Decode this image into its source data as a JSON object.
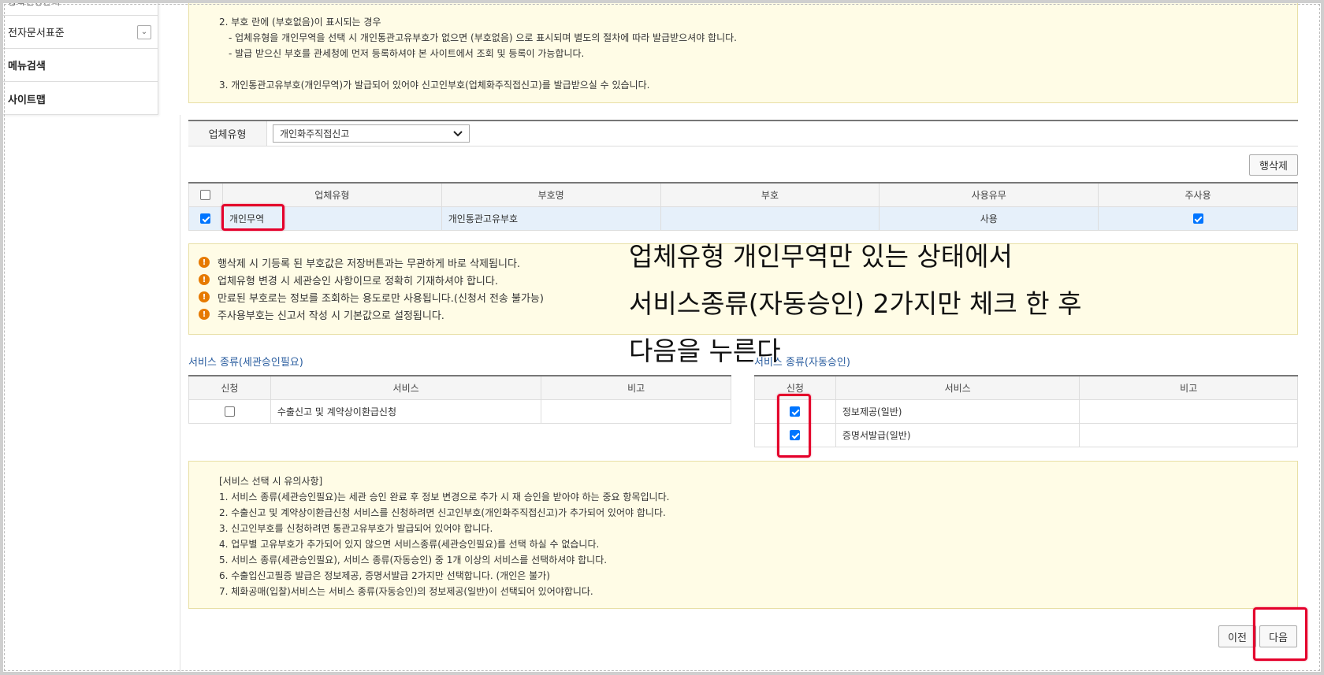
{
  "sidebar": {
    "top_cut": "등록신청관리",
    "items": [
      {
        "label": "전자문서표준",
        "has_toggle": true
      },
      {
        "label": "메뉴검색"
      },
      {
        "label": "사이트맵"
      }
    ],
    "toggle_glyph": "⌄"
  },
  "top_note": {
    "lines": [
      "2. 부호 란에 (부호없음)이 표시되는 경우",
      "  - 업체유형을 개인무역을 선택 시 개인통관고유부호가 없으면 (부호없음) 으로 표시되며 별도의 절차에 따라 발급받으셔야 합니다.",
      "  - 발급 받으신 부호를 관세청에 먼저 등록하셔야 본 사이트에서 조회 및 등록이 가능합니다.",
      "",
      "3. 개인통관고유부호(개인무역)가 발급되어 있어야 신고인부호(업체화주직접신고)를 발급받으실 수 있습니다."
    ]
  },
  "biz_type": {
    "label": "업체유형",
    "selected": "개인화주직접신고"
  },
  "buttons": {
    "delete_row": "행삭제",
    "prev": "이전",
    "next": "다음"
  },
  "code_table": {
    "headers": [
      "업체유형",
      "부호명",
      "부호",
      "사용유무",
      "주사용"
    ],
    "rows": [
      {
        "checked": true,
        "biz_type": "개인무역",
        "code_name": "개인통관고유부호",
        "code": "",
        "use": "사용",
        "main_use": true
      }
    ]
  },
  "warnings": [
    "행삭제 시 기등록 된 부호값은 저장버튼과는 무관하게 바로 삭제됩니다.",
    "업체유형 변경 시 세관승인 사항이므로 정확히 기재하셔야 합니다.",
    "만료된 부호로는 정보를 조회하는 용도로만 사용됩니다.(신청서 전송 불가능)",
    "주사용부호는 신고서 작성 시 기본값으로 설정됩니다."
  ],
  "service_customs": {
    "title": "서비스 종류(세관승인필요)",
    "headers": [
      "신청",
      "서비스",
      "비고"
    ],
    "rows": [
      {
        "checked": false,
        "service": "수출신고 및 계약상이환급신청",
        "note": ""
      }
    ]
  },
  "service_auto": {
    "title": "서비스 종류(자동승인)",
    "headers": [
      "신청",
      "서비스",
      "비고"
    ],
    "rows": [
      {
        "checked": true,
        "service": "정보제공(일반)",
        "note": ""
      },
      {
        "checked": true,
        "service": "증명서발급(일반)",
        "note": ""
      }
    ]
  },
  "bottom_note": {
    "lines": [
      "[서비스 선택 시 유의사항]",
      "1. 서비스 종류(세관승인필요)는 세관 승인 완료 후 정보 변경으로 추가 시 재 승인을 받아야 하는 중요 항목입니다.",
      "2. 수출신고 및 계약상이환급신청 서비스를 신청하려면 신고인부호(개인화주직접신고)가 추가되어 있어야 합니다.",
      "3. 신고인부호를 신청하려면 통관고유부호가 발급되어 있어야 합니다.",
      "4. 업무별 고유부호가 추가되어 있지 않으면 서비스종류(세관승인필요)를 선택 하실 수 없습니다.",
      "5. 서비스 종류(세관승인필요), 서비스 종류(자동승인) 중 1개 이상의 서비스를 선택하셔야 합니다.",
      "6. 수출입신고필증 발급은 정보제공, 증명서발급 2가지만 선택합니다. (개인은 불가)",
      "7. 체화공매(입찰)서비스는 서비스 종류(자동승인)의 정보제공(일반)이 선택되어 있어야합니다."
    ]
  },
  "annotation": {
    "lines": [
      "업체유형 개인무역만 있는 상태에서",
      "서비스종류(자동승인) 2가지만 체크 한 후",
      "다음을 누른다"
    ],
    "color": "#e4002b"
  },
  "colors": {
    "note_bg": "#fffce6",
    "warn_icon": "#e67a00",
    "section_title": "#2a5d9f",
    "checkbox_on": "#0075ff",
    "selected_row": "#e6f0fa"
  }
}
